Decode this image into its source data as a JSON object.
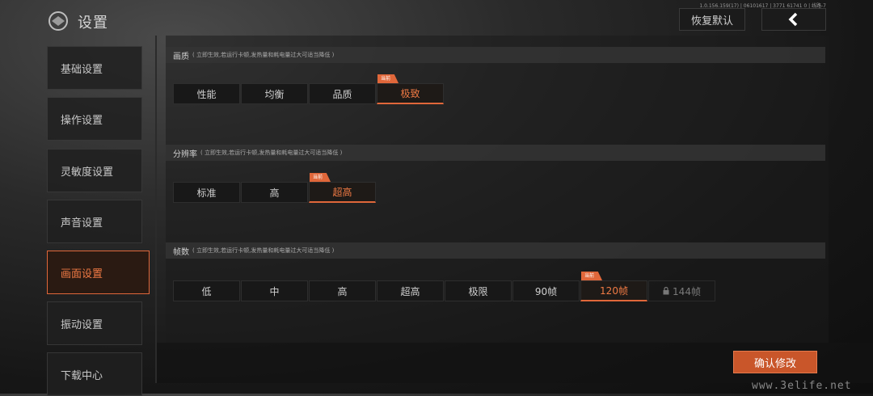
{
  "header": {
    "title": "设置",
    "version": "1.0.156.159(17) | 06101617 | 3771 61741 0 | 线路-7",
    "reset_label": "恢复默认",
    "back_icon": "chevron-left-icon"
  },
  "sidebar": {
    "items": [
      {
        "label": "基础设置",
        "active": false
      },
      {
        "label": "操作设置",
        "active": false
      },
      {
        "label": "灵敏度设置",
        "active": false
      },
      {
        "label": "声音设置",
        "active": false
      },
      {
        "label": "画面设置",
        "active": true
      },
      {
        "label": "振动设置",
        "active": false
      },
      {
        "label": "下载中心",
        "active": false
      }
    ]
  },
  "sections": {
    "quality": {
      "title": "画质",
      "note": "( 立即生效,若运行卡顿,发热量和耗电量过大可适当降低 )",
      "options": [
        "性能",
        "均衡",
        "品质",
        "极致"
      ],
      "selected": "极致",
      "tag": "当前"
    },
    "resolution": {
      "title": "分辨率",
      "note": "( 立即生效,若运行卡顿,发热量和耗电量过大可适当降低 )",
      "options": [
        "标准",
        "高",
        "超高"
      ],
      "selected": "超高",
      "tag": "当前"
    },
    "framerate": {
      "title": "帧数",
      "note": "( 立即生效,若运行卡顿,发热量和耗电量过大可适当降低 )",
      "options": [
        "低",
        "中",
        "高",
        "超高",
        "极限",
        "90帧",
        "120帧"
      ],
      "locked_option": "144帧",
      "selected": "120帧",
      "tag": "当前"
    }
  },
  "footer": {
    "confirm_label": "确认修改",
    "watermark": "www.3elife.net"
  },
  "colors": {
    "accent": "#e0673a",
    "accent_text": "#f07a44",
    "panel": "#181818"
  }
}
